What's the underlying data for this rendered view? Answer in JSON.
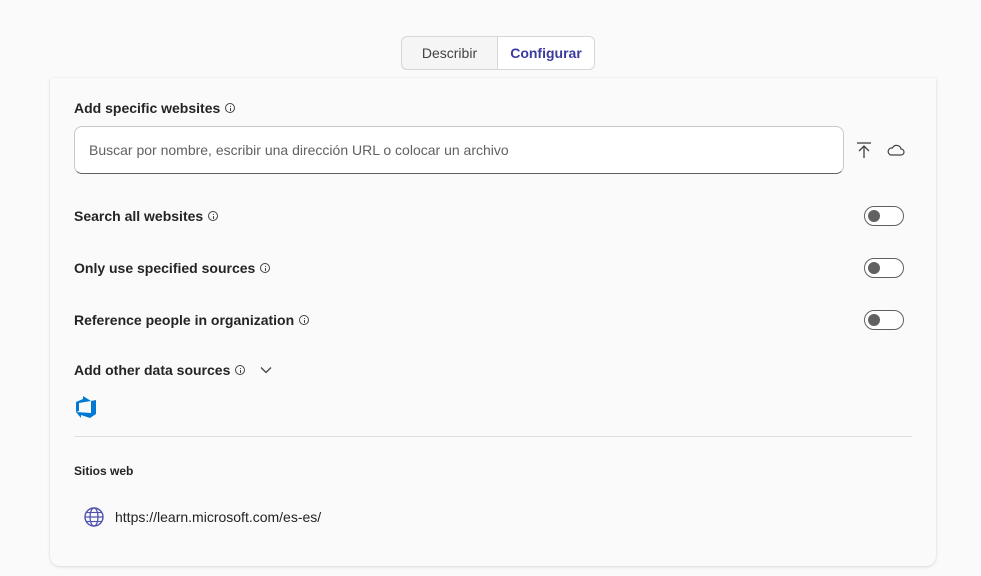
{
  "tabs": [
    {
      "label": "Describir",
      "active": false
    },
    {
      "label": "Configurar",
      "active": true
    }
  ],
  "websites": {
    "label": "Add specific websites",
    "search_placeholder": "Buscar por nombre, escribir una dirección URL o colocar un archivo",
    "search_value": "",
    "upload_icon": "upload-arrow-icon",
    "cloud_icon": "cloud-icon"
  },
  "toggles": [
    {
      "label": "Search all websites",
      "on": false
    },
    {
      "label": "Only use specified sources",
      "on": false
    },
    {
      "label": "Reference people in organization",
      "on": false
    }
  ],
  "other_sources": {
    "label": "Add other data sources",
    "expand_icon": "chevron-down-icon",
    "source_icon": "azure-devops-icon"
  },
  "sitios": {
    "title": "Sitios web",
    "items": [
      {
        "url": "https://learn.microsoft.com/es-es/",
        "icon": "globe-icon"
      }
    ]
  },
  "colors": {
    "accent": "#3b3b9e",
    "devops_blue": "#0078d4",
    "globe": "#4f52b2",
    "toggle_off": "#616161"
  }
}
